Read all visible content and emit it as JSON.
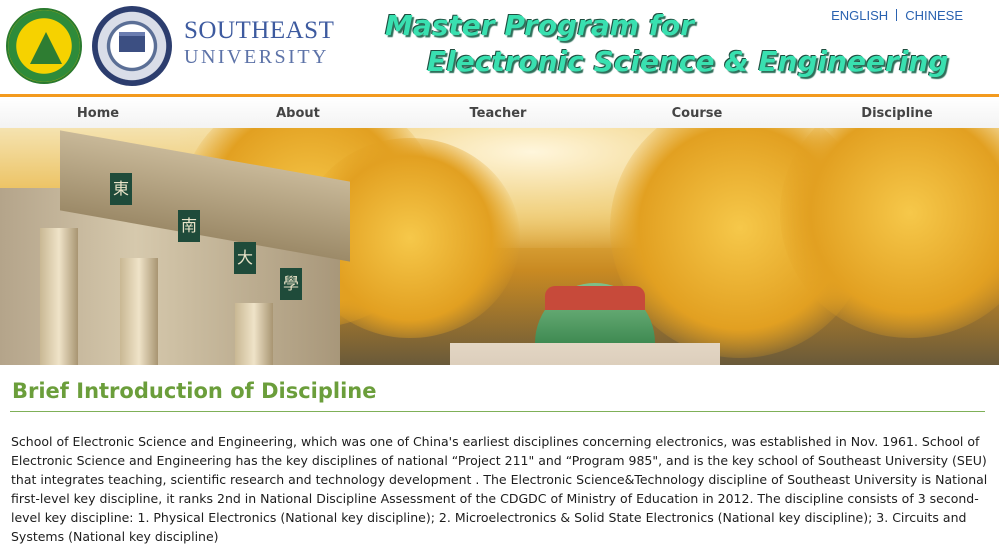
{
  "header": {
    "university_line1": "SOUTHEAST",
    "university_line2": "UNIVERSITY",
    "program_title_line1": "Master Program for",
    "program_title_line2": "Electronic Science & Engineering",
    "logo_left_icon": "university-seal-icon",
    "logo_right_icon": "institute-seal-icon"
  },
  "language": {
    "english_label": "ENGLISH",
    "chinese_label": "CHINESE"
  },
  "nav": {
    "items": [
      {
        "label": "Home"
      },
      {
        "label": "About"
      },
      {
        "label": "Teacher"
      },
      {
        "label": "Course"
      },
      {
        "label": "Discipline"
      }
    ]
  },
  "banner": {
    "gate_characters": [
      "東",
      "南",
      "大",
      "學"
    ]
  },
  "main": {
    "section_title": "Brief Introduction of Discipline",
    "intro_text": "School of Electronic Science and Engineering, which was one of China's earliest disciplines concerning electronics, was established in Nov. 1961. School of Electronic Science and Engineering has the key disciplines of national “Project 211\" and “Program 985\", and is the key school of Southeast University (SEU) that integrates teaching, scientific research and technology development . The Electronic Science&Technology discipline of Southeast University is National first-level key discipline, it ranks 2nd in National Discipline Assessment of the CDGDC of Ministry of Education in 2012. The discipline consists of 3 second-level key discipline: 1. Physical Electronics (National key discipline);   2. Microelectronics & Solid State Electronics (National key discipline);   3. Circuits and Systems (National key discipline)"
  },
  "colors": {
    "nav_accent": "#f39a1e",
    "title_green": "#6b9e3b",
    "program_teal": "#39e0b0",
    "link_blue": "#2a62b0"
  }
}
